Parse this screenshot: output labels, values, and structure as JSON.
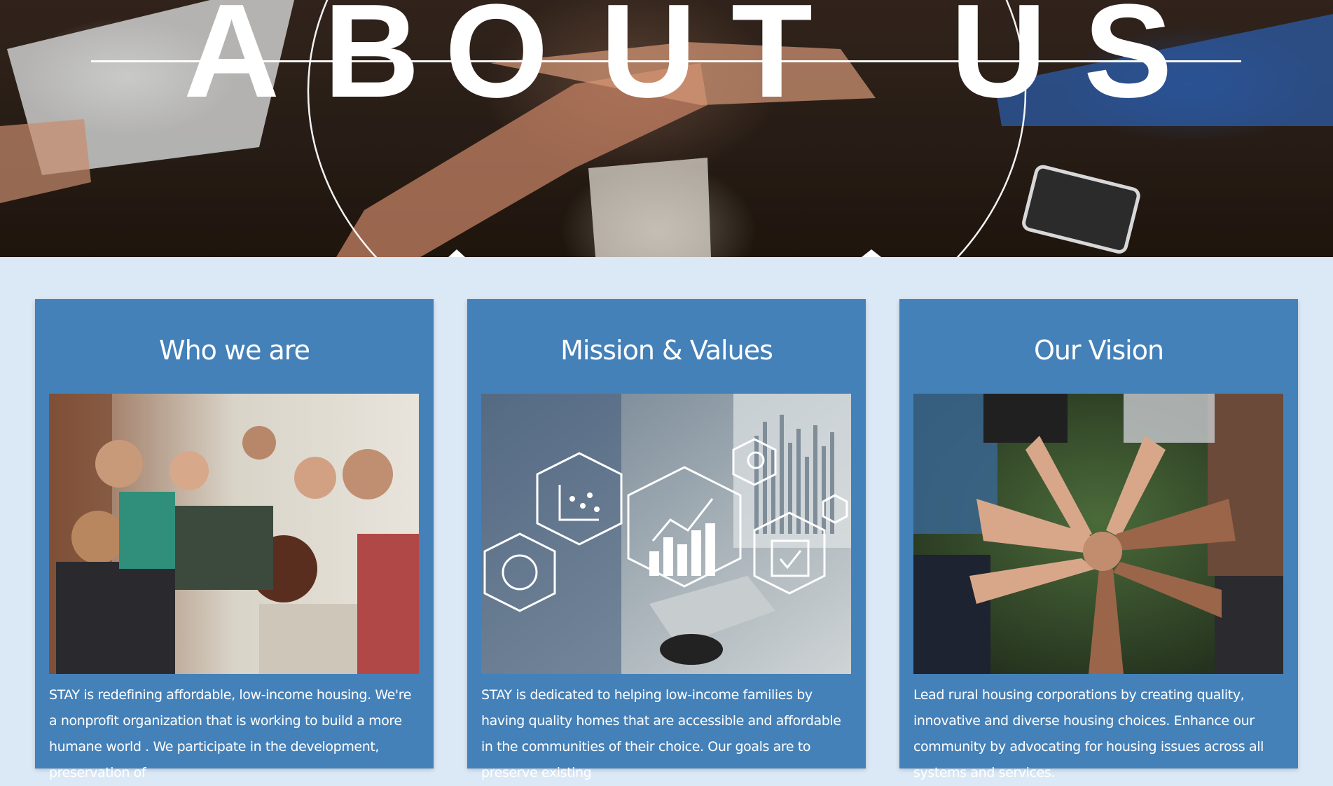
{
  "hero": {
    "title_letters": [
      "A",
      "B",
      "O",
      "U",
      "T",
      "U",
      "S"
    ]
  },
  "cards": [
    {
      "title": "Who we are",
      "photo_icon": "group-hug-photo-icon",
      "text": "STAY is redefining affordable, low-income housing. We're a nonprofit organization that is working to build a more humane world . We participate in the development, preservation of"
    },
    {
      "title": "Mission & Values",
      "photo_icon": "business-analytics-photo-icon",
      "text": "STAY is dedicated to helping low-income families by having quality homes that are accessible and affordable in the communities of their choice. Our goals are to preserve existing"
    },
    {
      "title": "Our Vision",
      "photo_icon": "stacked-hands-photo-icon",
      "text": "Lead rural housing corporations by creating quality, innovative and diverse housing choices. Enhance our community by advocating for housing issues across all systems and services."
    }
  ],
  "colors": {
    "page_background": "#dbe9f7",
    "card_background": "#4481b9",
    "text": "#ffffff"
  }
}
